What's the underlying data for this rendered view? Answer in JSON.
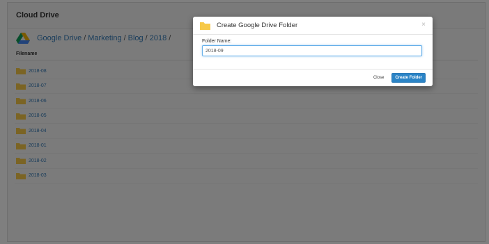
{
  "window": {
    "title": "Cloud Drive"
  },
  "breadcrumb": {
    "parts": [
      "Google Drive",
      "Marketing",
      "Blog",
      "2018"
    ],
    "separator": "/",
    "trailing": "/"
  },
  "table": {
    "column_header": "Filename",
    "rows": [
      "2018-08",
      "2018-07",
      "2018-06",
      "2018-05",
      "2018-04",
      "2018-01",
      "2018-02",
      "2018-03"
    ]
  },
  "modal": {
    "title": "Create Google Drive Folder",
    "close_symbol": "×",
    "field_label": "Folder Name:",
    "field_value": "2018-09",
    "close_button": "Close",
    "primary_button": "Create Folder"
  },
  "colors": {
    "link": "#337ab7",
    "primary_button": "#2b84c6",
    "folder": "#f7c948",
    "overlay": "rgba(0,0,0,0.5)"
  },
  "icons": {
    "drive": "google-drive-icon",
    "folder": "folder-icon"
  }
}
